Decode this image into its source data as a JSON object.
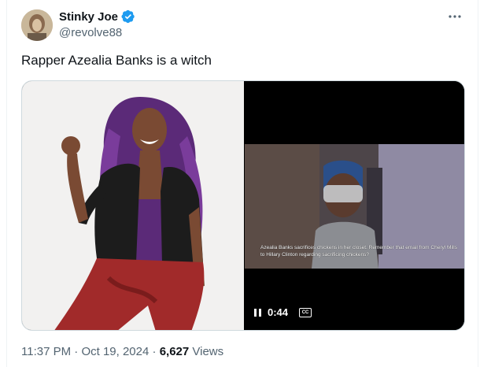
{
  "author": {
    "display_name": "Stinky Joe",
    "handle": "@revolve88",
    "verified": true,
    "avatar_icon": "avatar-photo"
  },
  "tweet": {
    "text": "Rapper Azealia Banks is a witch"
  },
  "media": {
    "photo_icon": "person-photo",
    "video": {
      "caption": "Azealia Banks sacrifices chickens in her closet. Remember that email from Cheryl Mills to Hillary Clinton regarding sacrificing chickens?",
      "time": "0:44",
      "cc_label": "CC"
    }
  },
  "meta": {
    "time": "11:37 PM",
    "sep1": " · ",
    "date": "Oct 19, 2024",
    "sep2": " · ",
    "views_count": "6,627",
    "views_label": " Views"
  },
  "colors": {
    "verified_blue": "#1d9bf0",
    "secondary_text": "#536471",
    "primary_text": "#0f1419"
  }
}
